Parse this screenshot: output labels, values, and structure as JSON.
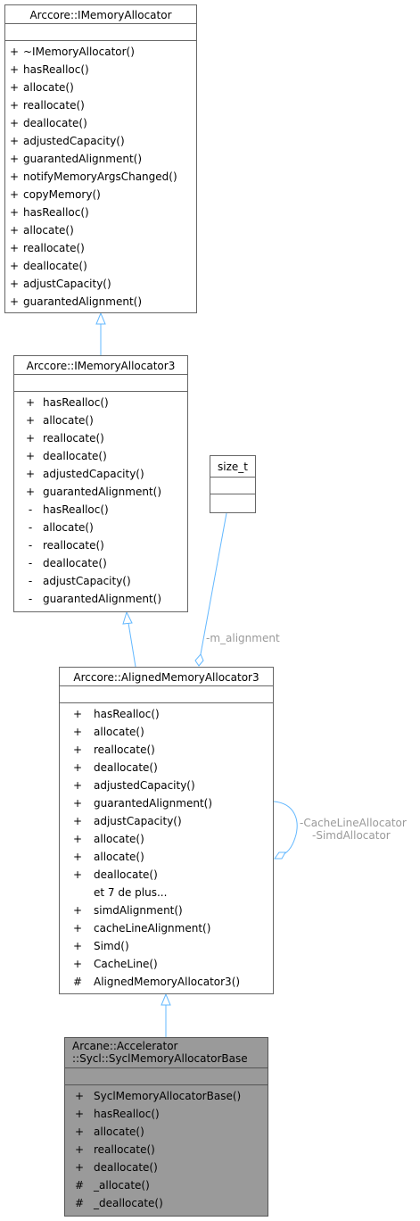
{
  "classes": {
    "imemalloc": {
      "title": "Arccore::IMemoryAllocator",
      "methods": [
        {
          "v": "+",
          "n": "~IMemoryAllocator()"
        },
        {
          "v": "+",
          "n": "hasRealloc()"
        },
        {
          "v": "+",
          "n": "allocate()"
        },
        {
          "v": "+",
          "n": "reallocate()"
        },
        {
          "v": "+",
          "n": "deallocate()"
        },
        {
          "v": "+",
          "n": "adjustedCapacity()"
        },
        {
          "v": "+",
          "n": "guarantedAlignment()"
        },
        {
          "v": "+",
          "n": "notifyMemoryArgsChanged()"
        },
        {
          "v": "+",
          "n": "copyMemory()"
        },
        {
          "v": "+",
          "n": "hasRealloc()"
        },
        {
          "v": "+",
          "n": "allocate()"
        },
        {
          "v": "+",
          "n": "reallocate()"
        },
        {
          "v": "+",
          "n": "deallocate()"
        },
        {
          "v": "+",
          "n": "adjustCapacity()"
        },
        {
          "v": "+",
          "n": "guarantedAlignment()"
        }
      ]
    },
    "imemalloc3": {
      "title": "Arccore::IMemoryAllocator3",
      "methods": [
        {
          "v": "+",
          "n": "hasRealloc()"
        },
        {
          "v": "+",
          "n": "allocate()"
        },
        {
          "v": "+",
          "n": "reallocate()"
        },
        {
          "v": "+",
          "n": "deallocate()"
        },
        {
          "v": "+",
          "n": "adjustedCapacity()"
        },
        {
          "v": "+",
          "n": "guarantedAlignment()"
        },
        {
          "v": "-",
          "n": "hasRealloc()"
        },
        {
          "v": "-",
          "n": "allocate()"
        },
        {
          "v": "-",
          "n": "reallocate()"
        },
        {
          "v": "-",
          "n": "deallocate()"
        },
        {
          "v": "-",
          "n": "adjustCapacity()"
        },
        {
          "v": "-",
          "n": "guarantedAlignment()"
        }
      ]
    },
    "sizet": {
      "title": "size_t"
    },
    "aligned": {
      "title": "Arccore::AlignedMemoryAllocator3",
      "methods": [
        {
          "v": "+",
          "n": "hasRealloc()"
        },
        {
          "v": "+",
          "n": "allocate()"
        },
        {
          "v": "+",
          "n": "reallocate()"
        },
        {
          "v": "+",
          "n": "deallocate()"
        },
        {
          "v": "+",
          "n": "adjustedCapacity()"
        },
        {
          "v": "+",
          "n": "guarantedAlignment()"
        },
        {
          "v": "+",
          "n": "adjustCapacity()"
        },
        {
          "v": "+",
          "n": "allocate()"
        },
        {
          "v": "+",
          "n": "allocate()"
        },
        {
          "v": "+",
          "n": "deallocate()"
        },
        {
          "v": "",
          "n": "et 7 de plus..."
        },
        {
          "v": "+",
          "n": "simdAlignment()"
        },
        {
          "v": "+",
          "n": "cacheLineAlignment()"
        },
        {
          "v": "+",
          "n": "Simd()"
        },
        {
          "v": "+",
          "n": "CacheLine()"
        },
        {
          "v": "#",
          "n": "AlignedMemoryAllocator3()"
        }
      ]
    },
    "sycl": {
      "title_line1": "Arcane::Accelerator",
      "title_line2": "::Sycl::SyclMemoryAllocatorBase",
      "methods": [
        {
          "v": "+",
          "n": "SyclMemoryAllocatorBase()"
        },
        {
          "v": "+",
          "n": "hasRealloc()"
        },
        {
          "v": "+",
          "n": "allocate()"
        },
        {
          "v": "+",
          "n": "reallocate()"
        },
        {
          "v": "+",
          "n": "deallocate()"
        },
        {
          "v": "#",
          "n": "_allocate()"
        },
        {
          "v": "#",
          "n": "_deallocate()"
        }
      ]
    }
  },
  "labels": {
    "m_alignment": "-m_alignment",
    "self_line1": "-CacheLineAllocator",
    "self_line2": "-SimdAllocator"
  },
  "colors": {
    "edge": "#63b8ff",
    "label": "#9a9a9a",
    "base_fill": "#9a9a9a"
  }
}
